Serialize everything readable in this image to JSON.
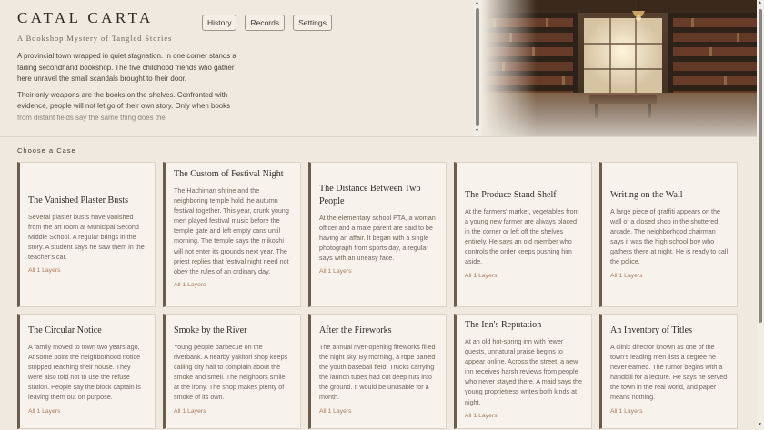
{
  "header": {
    "title": "CATAL CARTA",
    "subtitle": "A Bookshop Mystery of Tangled Stories"
  },
  "nav": [
    {
      "label": "History"
    },
    {
      "label": "Records"
    },
    {
      "label": "Settings"
    }
  ],
  "intro": [
    "A provincial town wrapped in quiet stagnation. In one corner stands a fading secondhand bookshop. The five childhood friends who gather here unravel the small scandals brought to their door.",
    "Their only weapons are the books on the shelves. Confronted with evidence, people will not let go of their own story. Only when books from distant fields say the same thing does the"
  ],
  "section_label": "Choose a Case",
  "cases": [
    {
      "title": "The Vanished Plaster Busts",
      "desc": "Several plaster busts have vanished from the art room at Municipal Second Middle School. A regular brings in the story. A student says he saw them in the teacher's car.",
      "meta": "All 1 Layers"
    },
    {
      "title": "The Custom of Festival Night",
      "desc": "The Hachiman shrine and the neighboring temple hold the autumn festival together. This year, drunk young men played festival music before the temple gate and left empty cans until morning. The temple says the mikoshi will not enter its grounds next year. The priest replies that festival night need not obey the rules of an ordinary day.",
      "meta": "All 1 Layers"
    },
    {
      "title": "The Distance Between Two People",
      "desc": "At the elementary school PTA, a woman officer and a male parent are said to be having an affair. It began with a single photograph from sports day, a regular says with an uneasy face.",
      "meta": "All 1 Layers"
    },
    {
      "title": "The Produce Stand Shelf",
      "desc": "At the farmers' market, vegetables from a young new farmer are always placed in the corner or left off the shelves entirely. He says an old member who controls the order keeps pushing him aside.",
      "meta": "All 1 Layers"
    },
    {
      "title": "Writing on the Wall",
      "desc": "A large piece of graffiti appears on the wall of a closed shop in the shuttered arcade. The neighborhood chairman says it was the high school boy who gathers there at night. He is ready to call the police.",
      "meta": "All 1 Layers"
    },
    {
      "title": "The Circular Notice",
      "desc": "A family moved to town two years ago. At some point the neighborhood notice stopped reaching their house. They were also told not to use the refuse station. People say the block captain is leaving them out on purpose.",
      "meta": "All 1 Layers"
    },
    {
      "title": "Smoke by the River",
      "desc": "Young people barbecue on the riverbank. A nearby yakitori shop keeps calling city hall to complain about the smoke and smell. The neighbors smile at the irony. The shop makes plenty of smoke of its own.",
      "meta": "All 1 Layers"
    },
    {
      "title": "After the Fireworks",
      "desc": "The annual river-opening fireworks filled the night sky. By morning, a rope barred the youth baseball field. Trucks carrying the launch tubes had cut deep ruts into the ground. It would be unusable for a month.",
      "meta": "All 1 Layers"
    },
    {
      "title": "The Inn's Reputation",
      "desc": "At an old hot-spring inn with fewer guests, unnatural praise begins to appear online. Across the street, a new inn receives harsh reviews from people who never stayed there. A maid says the young proprietress writes both kinds at night.",
      "meta": "All 1 Layers"
    },
    {
      "title": "An Inventory of Titles",
      "desc": "A clinic director known as one of the town's leading men lists a degree he never earned. The rumor begins with a handbill for a lecture. He says he served the town in the real world, and paper means nothing.",
      "meta": "All 1 Layers"
    }
  ]
}
